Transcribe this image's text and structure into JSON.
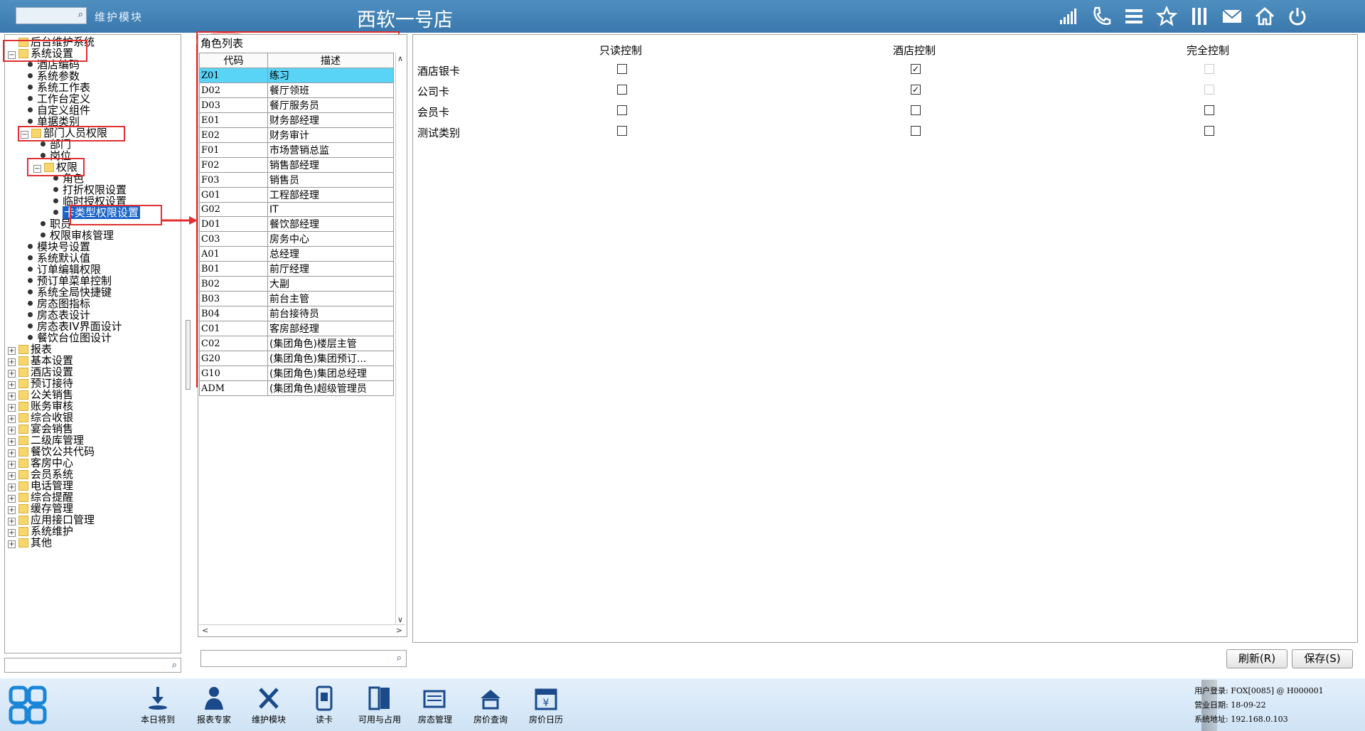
{
  "header": {
    "module_label": "维护模块",
    "store_title": "西软一号店",
    "icons": [
      "signal-icon",
      "phone-icon",
      "menu-icon",
      "star-icon",
      "columns-icon",
      "mail-icon",
      "home-icon",
      "power-icon"
    ]
  },
  "tree": {
    "items": [
      {
        "label": "后台维护系统",
        "level": 0,
        "type": "folder",
        "expander": ""
      },
      {
        "label": "系统设置",
        "level": 0,
        "type": "folder",
        "expander": "−"
      },
      {
        "label": "酒店编码",
        "level": 1,
        "type": "leaf"
      },
      {
        "label": "系统参数",
        "level": 1,
        "type": "leaf"
      },
      {
        "label": "系统工作表",
        "level": 1,
        "type": "leaf"
      },
      {
        "label": "工作台定义",
        "level": 1,
        "type": "leaf"
      },
      {
        "label": "自定义组件",
        "level": 1,
        "type": "leaf"
      },
      {
        "label": "单据类别",
        "level": 1,
        "type": "leaf"
      },
      {
        "label": "部门人员权限",
        "level": 1,
        "type": "folder",
        "expander": "−"
      },
      {
        "label": "部门",
        "level": 2,
        "type": "leaf"
      },
      {
        "label": "岗位",
        "level": 2,
        "type": "leaf"
      },
      {
        "label": "权限",
        "level": 2,
        "type": "folder",
        "expander": "−"
      },
      {
        "label": "角色",
        "level": 3,
        "type": "leaf"
      },
      {
        "label": "打折权限设置",
        "level": 3,
        "type": "leaf"
      },
      {
        "label": "临时授权设置",
        "level": 3,
        "type": "leaf"
      },
      {
        "label": "卡类型权限设置",
        "level": 3,
        "type": "leaf",
        "selected": true
      },
      {
        "label": "职员",
        "level": 2,
        "type": "leaf"
      },
      {
        "label": "权限审核管理",
        "level": 2,
        "type": "leaf"
      },
      {
        "label": "模块号设置",
        "level": 1,
        "type": "leaf"
      },
      {
        "label": "系统默认值",
        "level": 1,
        "type": "leaf"
      },
      {
        "label": "订单编辑权限",
        "level": 1,
        "type": "leaf"
      },
      {
        "label": "预订单菜单控制",
        "level": 1,
        "type": "leaf"
      },
      {
        "label": "系统全局快捷键",
        "level": 1,
        "type": "leaf"
      },
      {
        "label": "房态图指标",
        "level": 1,
        "type": "leaf"
      },
      {
        "label": "房态表设计",
        "level": 1,
        "type": "leaf"
      },
      {
        "label": "房态表IV界面设计",
        "level": 1,
        "type": "leaf"
      },
      {
        "label": "餐饮台位图设计",
        "level": 1,
        "type": "leaf"
      },
      {
        "label": "报表",
        "level": 0,
        "type": "folder",
        "expander": "+"
      },
      {
        "label": "基本设置",
        "level": 0,
        "type": "folder",
        "expander": "+"
      },
      {
        "label": "酒店设置",
        "level": 0,
        "type": "folder",
        "expander": "+"
      },
      {
        "label": "预订接待",
        "level": 0,
        "type": "folder",
        "expander": "+"
      },
      {
        "label": "公关销售",
        "level": 0,
        "type": "folder",
        "expander": "+"
      },
      {
        "label": "账务审核",
        "level": 0,
        "type": "folder",
        "expander": "+"
      },
      {
        "label": "综合收银",
        "level": 0,
        "type": "folder",
        "expander": "+"
      },
      {
        "label": "宴会销售",
        "level": 0,
        "type": "folder",
        "expander": "+"
      },
      {
        "label": "二级库管理",
        "level": 0,
        "type": "folder",
        "expander": "+"
      },
      {
        "label": "餐饮公共代码",
        "level": 0,
        "type": "folder",
        "expander": "+"
      },
      {
        "label": "客房中心",
        "level": 0,
        "type": "folder",
        "expander": "+"
      },
      {
        "label": "会员系统",
        "level": 0,
        "type": "folder",
        "expander": "+"
      },
      {
        "label": "电话管理",
        "level": 0,
        "type": "folder",
        "expander": "+"
      },
      {
        "label": "综合提醒",
        "level": 0,
        "type": "folder",
        "expander": "+"
      },
      {
        "label": "缓存管理",
        "level": 0,
        "type": "folder",
        "expander": "+"
      },
      {
        "label": "应用接口管理",
        "level": 0,
        "type": "folder",
        "expander": "+"
      },
      {
        "label": "系统维护",
        "level": 0,
        "type": "folder",
        "expander": "+"
      },
      {
        "label": "其他",
        "level": 0,
        "type": "folder",
        "expander": "+"
      }
    ]
  },
  "roles": {
    "title": "角色列表",
    "columns": [
      "代码",
      "描述"
    ],
    "rows": [
      {
        "code": "Z01",
        "desc": "练习",
        "selected": true
      },
      {
        "code": "D02",
        "desc": "餐厅领班"
      },
      {
        "code": "D03",
        "desc": "餐厅服务员"
      },
      {
        "code": "E01",
        "desc": "财务部经理"
      },
      {
        "code": "E02",
        "desc": "财务审计"
      },
      {
        "code": "F01",
        "desc": "市场营销总监"
      },
      {
        "code": "F02",
        "desc": "销售部经理"
      },
      {
        "code": "F03",
        "desc": "销售员"
      },
      {
        "code": "G01",
        "desc": "工程部经理"
      },
      {
        "code": "G02",
        "desc": "IT"
      },
      {
        "code": "D01",
        "desc": "餐饮部经理"
      },
      {
        "code": "C03",
        "desc": "房务中心"
      },
      {
        "code": "A01",
        "desc": "总经理"
      },
      {
        "code": "B01",
        "desc": "前厅经理"
      },
      {
        "code": "B02",
        "desc": "大副"
      },
      {
        "code": "B03",
        "desc": "前台主管"
      },
      {
        "code": "B04",
        "desc": "前台接待员"
      },
      {
        "code": "C01",
        "desc": "客房部经理"
      },
      {
        "code": "C02",
        "desc": "(集团角色)楼层主管"
      },
      {
        "code": "G20",
        "desc": "(集团角色)集团预订..."
      },
      {
        "code": "G10",
        "desc": "(集团角色)集团总经理"
      },
      {
        "code": "ADM",
        "desc": "(集团角色)超级管理员"
      }
    ]
  },
  "controls": {
    "headers": [
      "只读控制",
      "酒店控制",
      "完全控制"
    ],
    "cards": [
      {
        "name": "酒店银卡",
        "readonly": false,
        "hotel": true,
        "full": false,
        "full_disabled": true
      },
      {
        "name": "公司卡",
        "readonly": false,
        "hotel": true,
        "full": false,
        "full_disabled": true
      },
      {
        "name": "会员卡",
        "readonly": false,
        "hotel": false,
        "full": false,
        "full_disabled": false
      },
      {
        "name": "测试类别",
        "readonly": false,
        "hotel": false,
        "full": false,
        "full_disabled": false
      }
    ]
  },
  "buttons": {
    "refresh": "刷新(R)",
    "save": "保存(S)"
  },
  "toolbar": {
    "items": [
      {
        "label": "本日将到",
        "icon": "arrival-icon"
      },
      {
        "label": "报表专家",
        "icon": "report-expert-icon"
      },
      {
        "label": "维护模块",
        "icon": "tools-icon"
      },
      {
        "label": "读卡",
        "icon": "card-reader-icon"
      },
      {
        "label": "可用与占用",
        "icon": "door-icon"
      },
      {
        "label": "房态管理",
        "icon": "room-status-icon"
      },
      {
        "label": "房价查询",
        "icon": "room-rate-icon"
      },
      {
        "label": "房价日历",
        "icon": "calendar-icon"
      }
    ]
  },
  "status": {
    "user": "用户登录: FOX[0085] @ H000001",
    "business_date": "营业日期: 18-09-22",
    "address": "系统地址: 192.168.0.103"
  },
  "colors": {
    "topbar": "#3a78ad",
    "selected_row": "#5ad4f6",
    "highlight_box": "#e03030",
    "tree_selected": "#1a64c8"
  }
}
